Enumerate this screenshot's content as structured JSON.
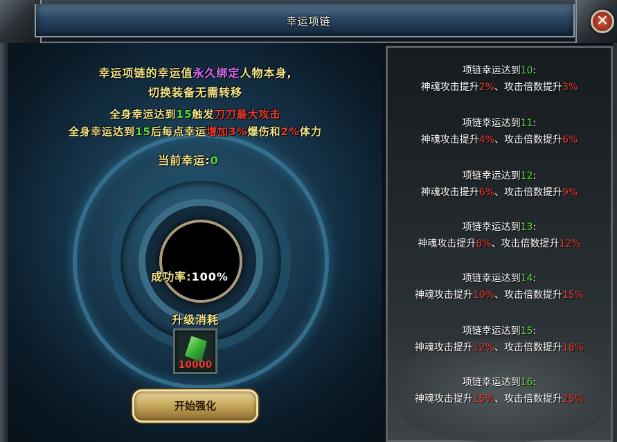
{
  "window": {
    "title": "幸运项链",
    "close_glyph": "✕"
  },
  "info": {
    "line1": {
      "a": "幸运项链的幸运值",
      "b": "永久绑定",
      "c": "人物本身,"
    },
    "line2": "切换装备无需转移",
    "line3": {
      "a": "全身幸运达到",
      "b": "15",
      "c": "触发",
      "d": "刀刀最大攻击"
    },
    "line4": {
      "a": "全身幸运达到",
      "b": "15",
      "c": "后每点幸运",
      "d": "增加",
      "e": "3%",
      "f": "爆伤和",
      "g": "2%",
      "h": "体力"
    }
  },
  "current_luck": {
    "label": "当前幸运:",
    "value": "0"
  },
  "success_rate": {
    "label": "成功率:",
    "value": "100%"
  },
  "upgrade_cost": {
    "label": "升级消耗",
    "item_icon": "green-gem-icon",
    "count": "10000"
  },
  "start_button": "开始强化",
  "tiers": [
    {
      "head": "项链幸运达到",
      "level": "10",
      "colon": ":",
      "a": "神魂攻击提升",
      "soul": "2%",
      "b": "、攻击倍数提升",
      "mult": "3%"
    },
    {
      "head": "项链幸运达到",
      "level": "11",
      "colon": ":",
      "a": "神魂攻击提升",
      "soul": "4%",
      "b": "、攻击倍数提升",
      "mult": "6%"
    },
    {
      "head": "项链幸运达到",
      "level": "12",
      "colon": ":",
      "a": "神魂攻击提升",
      "soul": "6%",
      "b": "、攻击倍数提升",
      "mult": "9%"
    },
    {
      "head": "项链幸运达到",
      "level": "13",
      "colon": ":",
      "a": "神魂攻击提升",
      "soul": "8%",
      "b": "、攻击倍数提升",
      "mult": "12%"
    },
    {
      "head": "项链幸运达到",
      "level": "14",
      "colon": ":",
      "a": "神魂攻击提升",
      "soul": "10%",
      "b": "、攻击倍数提升",
      "mult": "15%"
    },
    {
      "head": "项链幸运达到",
      "level": "15",
      "colon": ":",
      "a": "神魂攻击提升",
      "soul": "12%",
      "b": "、攻击倍数提升",
      "mult": "18%"
    },
    {
      "head": "项链幸运达到",
      "level": "16",
      "colon": ":",
      "a": "神魂攻击提升",
      "soul": "15%",
      "b": "、攻击倍数提升",
      "mult": "25%"
    }
  ],
  "colors": {
    "highlight_yellow": "#f2e489",
    "bind_purple": "#d86bf0",
    "number_green": "#5ad83a",
    "value_red": "#ee3a2d"
  }
}
